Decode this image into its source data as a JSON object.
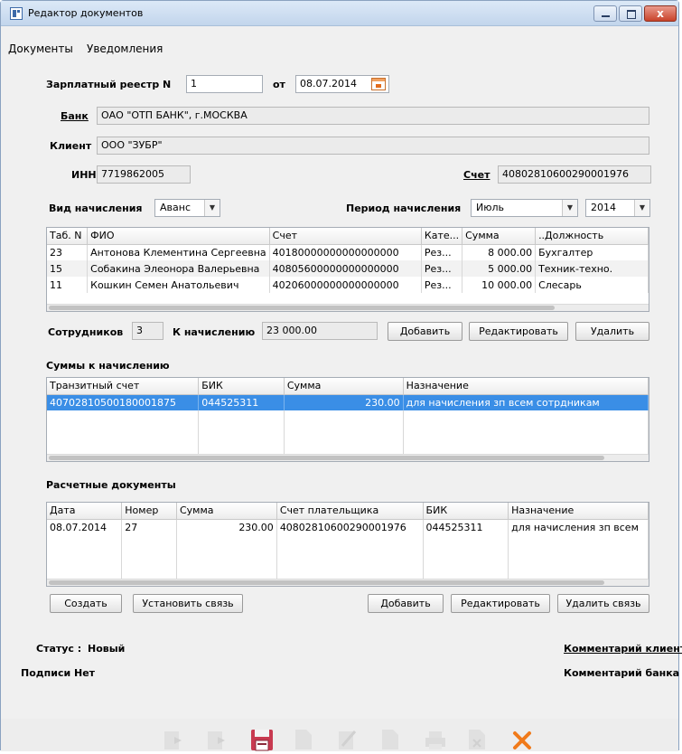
{
  "window": {
    "title": "Редактор документов",
    "close_glyph": "x"
  },
  "menu": [
    "Документы",
    "Уведомления"
  ],
  "header": {
    "registry_label": "Зарплатный реестр  N",
    "registry_number": "1",
    "date_label": "от",
    "date_value": "08.07.2014",
    "bank_label": "Банк",
    "bank_value": "ОАО \"ОТП БАНК\", г.МОСКВА",
    "client_label": "Клиент",
    "client_value": "ООО \"ЗУБР\"",
    "inn_label": "ИНН",
    "inn_value": "7719862005",
    "account_label": "Счет",
    "account_value": "40802810600290001976"
  },
  "accrual": {
    "type_label": "Вид начисления",
    "type_value": "Аванс",
    "period_label": "Период начисления",
    "month_value": "Июль",
    "year_value": "2014"
  },
  "employees": {
    "columns": [
      "Таб. N",
      "ФИО",
      "Счет",
      "Кате...",
      "Сумма",
      "..Должность"
    ],
    "rows": [
      [
        "23",
        "Антонова Клементина Сергеевна",
        "40180000000000000000",
        "Рез...",
        "8 000.00",
        "Бухгалтер"
      ],
      [
        "15",
        "Собакина Элеонора Валерьевна",
        "40805600000000000000",
        "Рез...",
        "5 000.00",
        "Техник-техно."
      ],
      [
        "11",
        "Кошкин Семен Анатольевич",
        "40206000000000000000",
        "Рез...",
        "10 000.00",
        "Слесарь"
      ]
    ],
    "count_label": "Сотрудников",
    "count_value": "3",
    "total_label": "К начислению",
    "total_value": "23 000.00",
    "add_label": "Добавить",
    "edit_label": "Редактировать",
    "delete_label": "Удалить"
  },
  "sums": {
    "section_title": "Суммы к начислению",
    "columns": [
      "Транзитный счет",
      "БИК",
      "Сумма",
      "Назначение"
    ],
    "rows": [
      [
        "40702810500180001875",
        "044525311",
        "230.00",
        "для начисления зп всем сотрдникам"
      ]
    ]
  },
  "payments": {
    "section_title": "Расчетные документы",
    "columns": [
      "Дата",
      "Номер",
      "Сумма",
      "Счет плательщика",
      "БИК",
      "Назначение"
    ],
    "rows": [
      [
        "08.07.2014",
        "27",
        "230.00",
        "40802810600290001976",
        "044525311",
        "для начисления зп всем"
      ]
    ],
    "create_label": "Создать",
    "link_label": "Установить связь",
    "add_label": "Добавить",
    "edit_label": "Редактировать",
    "unlink_label": "Удалить связь"
  },
  "footer": {
    "status_label": "Статус :",
    "status_value": "Новый",
    "signatures_label": "Подписи :",
    "signatures_value": "Нет",
    "client_comment": "Комментарий клиента",
    "bank_comment": "Комментарий банка"
  },
  "toolbar": {
    "icons": [
      "import-icon",
      "export-icon",
      "save-icon",
      "document-icon",
      "edit-icon",
      "document-icon",
      "print-icon",
      "delete-doc-icon",
      "close-icon"
    ],
    "accent_color": "#f07a1a",
    "save_color": "#c83a50"
  }
}
